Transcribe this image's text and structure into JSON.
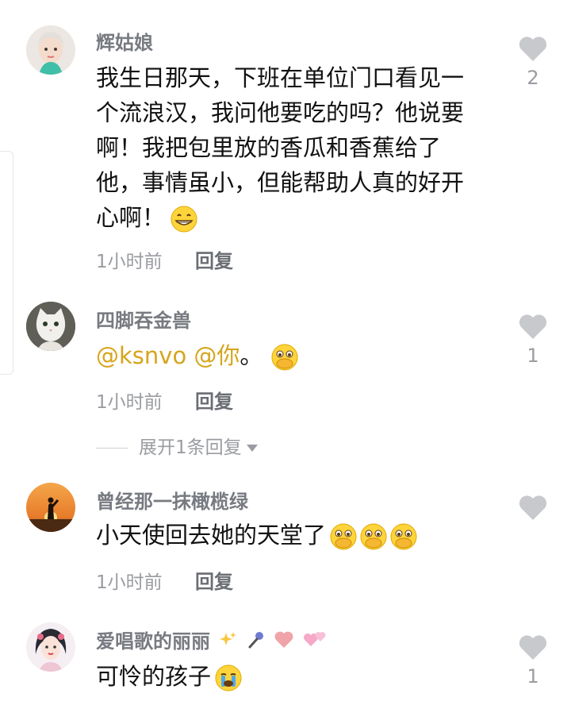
{
  "comments": [
    {
      "username": "辉姑娘",
      "text": "我生日那天，下班在单位门口看见一个流浪汉，我问他要吃的吗？他说要啊！我把包里放的香瓜和香蕉给了他，事情虽小，但能帮助人真的好开心啊！",
      "text_lines": [
        "我生日那天，下班在单位门口看见一",
        "个流浪汉，我问他要吃的吗？他说要",
        "啊！我把包里放的香瓜和香蕉给了",
        "他，事情虽小，但能帮助人真的好开",
        "心啊！"
      ],
      "emojis": [
        "grin-emoji"
      ],
      "time": "1小时前",
      "reply_label": "回复",
      "likes": "2"
    },
    {
      "username": "四脚吞金兽",
      "mention": "@ksnvo @你",
      "text": "。",
      "emojis": [
        "pleading-hands-emoji"
      ],
      "time": "1小时前",
      "reply_label": "回复",
      "likes": "1",
      "expand_label": "展开1条回复"
    },
    {
      "username": "曾经那一抹橄榄绿",
      "text": "小天使回去她的天堂了",
      "emojis": [
        "pleading-hands-emoji",
        "pleading-hands-emoji",
        "pleading-hands-emoji"
      ],
      "time": "1小时前",
      "reply_label": "回复",
      "likes": ""
    },
    {
      "username": "爱唱歌的丽丽",
      "username_icons": [
        "sparkles-icon",
        "microphone-icon",
        "heart-icon",
        "two-hearts-icon"
      ],
      "text": "可怜的孩子",
      "emojis": [
        "crying-emoji"
      ],
      "likes": "1"
    }
  ],
  "colors": {
    "mention": "#d6a51c",
    "like_heart": "#c8c9cd",
    "username": "#777a80",
    "meta": "#9a9ca2"
  }
}
